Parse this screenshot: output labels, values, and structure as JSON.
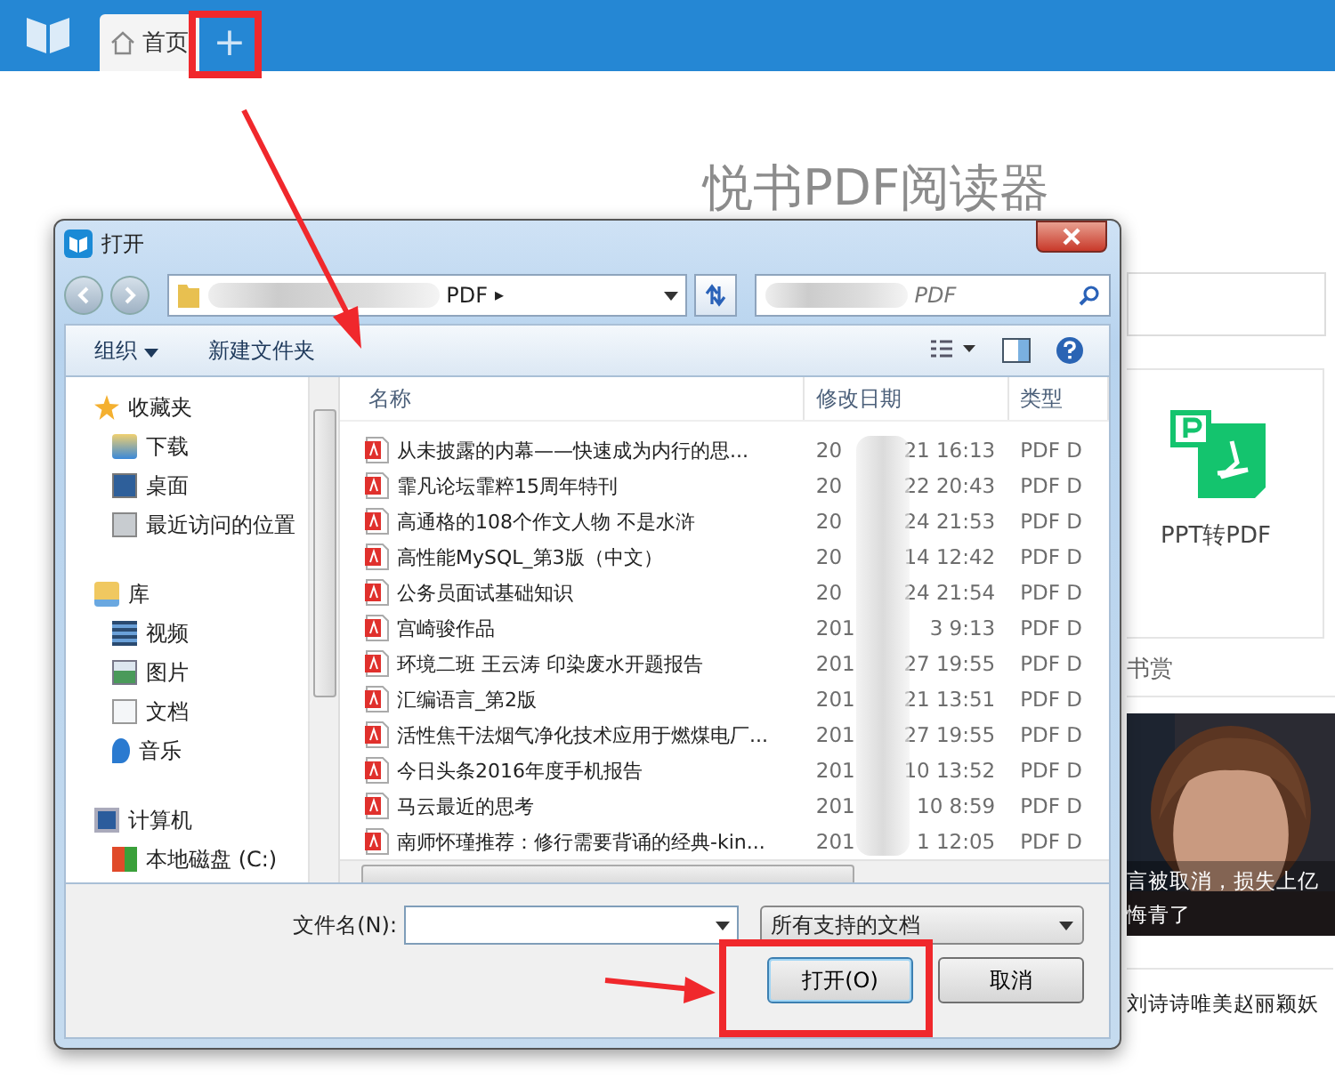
{
  "app": {
    "tabs": [
      {
        "label": "首页",
        "selected": true
      }
    ],
    "add_tab": "+",
    "heading": "悦书PDF阅读器",
    "tool": {
      "label": "PPT转PDF"
    },
    "section": "书赏",
    "news": {
      "caption_lines": [
        "言被取消，损失上亿",
        "悔青了"
      ],
      "headline": "刘诗诗唯美赵丽颖妖"
    }
  },
  "dialog": {
    "title": "打开",
    "address": {
      "path_end": "PDF",
      "separator": "▸"
    },
    "search": {
      "placeholder": "PDF"
    },
    "toolbar": {
      "organize": "组织",
      "new_folder": "新建文件夹"
    },
    "nav": [
      {
        "label": "收藏夹",
        "children": [
          {
            "label": "下载"
          },
          {
            "label": "桌面"
          },
          {
            "label": "最近访问的位置"
          }
        ]
      },
      {
        "label": "库",
        "children": [
          {
            "label": "视频"
          },
          {
            "label": "图片"
          },
          {
            "label": "文档"
          },
          {
            "label": "音乐"
          }
        ]
      },
      {
        "label": "计算机",
        "children": [
          {
            "label": "本地磁盘 (C:)"
          }
        ]
      }
    ],
    "columns": [
      "名称",
      "修改日期",
      "类型"
    ],
    "files": [
      {
        "name": "从未披露的内幕——快速成为内行的思...",
        "date_start": "20",
        "date_end": "21 16:13",
        "type": "PDF D"
      },
      {
        "name": "霏凡论坛霏粹15周年特刊",
        "date_start": "20",
        "date_end": "22 20:43",
        "type": "PDF D"
      },
      {
        "name": "高通格的108个作文人物 不是水浒",
        "date_start": "20",
        "date_end": "24 21:53",
        "type": "PDF D"
      },
      {
        "name": "高性能MySQL_第3版（中文）",
        "date_start": "20",
        "date_end": "14 12:42",
        "type": "PDF D"
      },
      {
        "name": "公务员面试基础知识",
        "date_start": "20",
        "date_end": "24 21:54",
        "type": "PDF D"
      },
      {
        "name": "宫崎骏作品",
        "date_start": "201",
        "date_end": "3 9:13",
        "type": "PDF D"
      },
      {
        "name": "环境二班 王云涛 印染废水开题报告",
        "date_start": "201",
        "date_end": "27 19:55",
        "type": "PDF D"
      },
      {
        "name": "汇编语言_第2版",
        "date_start": "201",
        "date_end": "21 13:51",
        "type": "PDF D"
      },
      {
        "name": "活性焦干法烟气净化技术应用于燃煤电厂...",
        "date_start": "201",
        "date_end": "27 19:55",
        "type": "PDF D"
      },
      {
        "name": "今日头条2016年度手机报告",
        "date_start": "201",
        "date_end": "10 13:52",
        "type": "PDF D"
      },
      {
        "name": "马云最近的思考",
        "date_start": "201",
        "date_end": "10 8:59",
        "type": "PDF D"
      },
      {
        "name": "南师怀瑾推荐：修行需要背诵的经典-kin...",
        "date_start": "201",
        "date_end": "1 12:05",
        "type": "PDF D"
      }
    ],
    "file_name_label": "文件名(N):",
    "filter": "所有支持的文档",
    "buttons": [
      {
        "label": "打开(O)",
        "default": true
      },
      {
        "label": "取消",
        "default": false
      }
    ]
  }
}
